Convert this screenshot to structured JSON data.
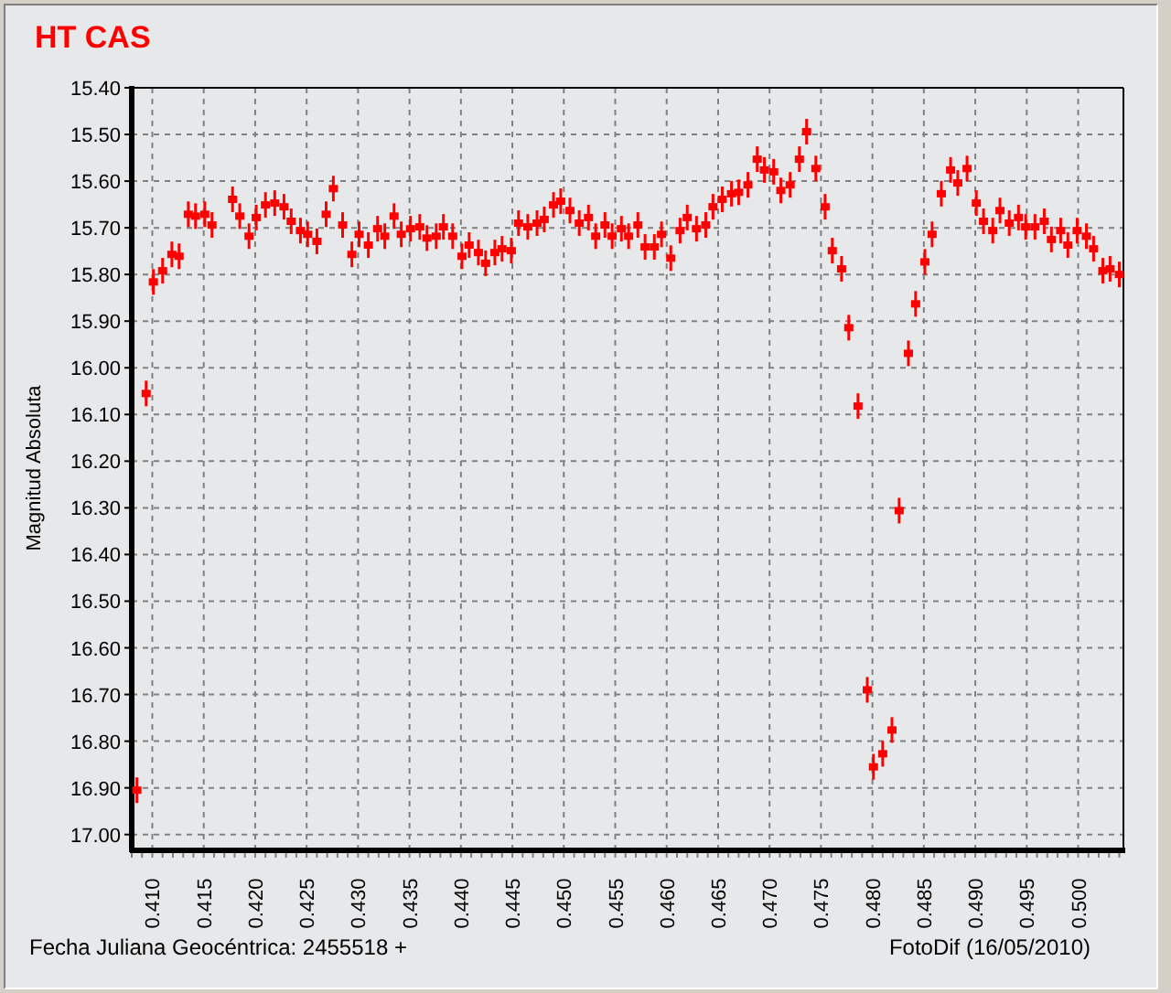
{
  "chart_data": {
    "type": "scatter",
    "title": "HT CAS",
    "xlabel": "Fecha Juliana Geocéntrica: 2455518 +",
    "ylabel": "Magnitud Absoluta",
    "grid": true,
    "xlim": [
      0.408,
      0.5044
    ],
    "ylim": [
      17.03,
      15.4
    ],
    "xticks": [
      {
        "value": 0.41,
        "label": "0.410"
      },
      {
        "value": 0.415,
        "label": "0.415"
      },
      {
        "value": 0.42,
        "label": "0.420"
      },
      {
        "value": 0.425,
        "label": "0.425"
      },
      {
        "value": 0.43,
        "label": "0.430"
      },
      {
        "value": 0.435,
        "label": "0.435"
      },
      {
        "value": 0.44,
        "label": "0.440"
      },
      {
        "value": 0.445,
        "label": "0.445"
      },
      {
        "value": 0.45,
        "label": "0.450"
      },
      {
        "value": 0.455,
        "label": "0.455"
      },
      {
        "value": 0.46,
        "label": "0.460"
      },
      {
        "value": 0.465,
        "label": "0.465"
      },
      {
        "value": 0.47,
        "label": "0.470"
      },
      {
        "value": 0.475,
        "label": "0.475"
      },
      {
        "value": 0.48,
        "label": "0.480"
      },
      {
        "value": 0.485,
        "label": "0.485"
      },
      {
        "value": 0.49,
        "label": "0.490"
      },
      {
        "value": 0.495,
        "label": "0.495"
      },
      {
        "value": 0.5,
        "label": "0.500"
      }
    ],
    "yticks": [
      {
        "value": 15.4,
        "label": "15.40"
      },
      {
        "value": 15.5,
        "label": "15.50"
      },
      {
        "value": 15.6,
        "label": "15.60"
      },
      {
        "value": 15.7,
        "label": "15.70"
      },
      {
        "value": 15.8,
        "label": "15.80"
      },
      {
        "value": 15.9,
        "label": "15.90"
      },
      {
        "value": 16.0,
        "label": "16.00"
      },
      {
        "value": 16.1,
        "label": "16.10"
      },
      {
        "value": 16.2,
        "label": "16.20"
      },
      {
        "value": 16.3,
        "label": "16.30"
      },
      {
        "value": 16.4,
        "label": "16.40"
      },
      {
        "value": 16.5,
        "label": "16.50"
      },
      {
        "value": 16.6,
        "label": "16.60"
      },
      {
        "value": 16.7,
        "label": "16.70"
      },
      {
        "value": 16.8,
        "label": "16.80"
      },
      {
        "value": 16.9,
        "label": "16.90"
      },
      {
        "value": 17.0,
        "label": "17.00"
      }
    ],
    "x": [
      0.4085,
      0.4094,
      0.4101,
      0.411,
      0.4119,
      0.4126,
      0.4135,
      0.4142,
      0.4151,
      0.4158,
      0.4178,
      0.4185,
      0.4194,
      0.4201,
      0.421,
      0.4219,
      0.4228,
      0.4235,
      0.4244,
      0.4251,
      0.426,
      0.4269,
      0.4276,
      0.4285,
      0.4294,
      0.4301,
      0.431,
      0.4319,
      0.4326,
      0.4335,
      0.4342,
      0.4351,
      0.436,
      0.4367,
      0.4376,
      0.4383,
      0.4392,
      0.4401,
      0.4408,
      0.4417,
      0.4424,
      0.4433,
      0.444,
      0.4449,
      0.4456,
      0.4465,
      0.4474,
      0.4481,
      0.449,
      0.4497,
      0.4506,
      0.4515,
      0.4524,
      0.4531,
      0.454,
      0.4547,
      0.4556,
      0.4563,
      0.4572,
      0.4579,
      0.4588,
      0.4595,
      0.4604,
      0.4613,
      0.462,
      0.4629,
      0.4638,
      0.4645,
      0.4654,
      0.4663,
      0.467,
      0.4679,
      0.4688,
      0.4695,
      0.4704,
      0.4711,
      0.472,
      0.4729,
      0.4736,
      0.4745,
      0.4754,
      0.4761,
      0.477,
      0.4777,
      0.4786,
      0.4795,
      0.4801,
      0.481,
      0.4819,
      0.4826,
      0.4835,
      0.4842,
      0.4851,
      0.4858,
      0.4867,
      0.4876,
      0.4883,
      0.4892,
      0.4901,
      0.4908,
      0.4917,
      0.4924,
      0.4933,
      0.4942,
      0.4949,
      0.4958,
      0.4967,
      0.4974,
      0.4983,
      0.499,
      0.4999,
      0.5008,
      0.5015,
      0.5024,
      0.5031,
      0.504
    ],
    "series": [
      {
        "color": "#ff0000",
        "values": [
          16.905,
          16.055,
          15.816,
          15.792,
          15.757,
          15.761,
          15.671,
          15.675,
          15.671,
          15.694,
          15.639,
          15.675,
          15.718,
          15.678,
          15.651,
          15.647,
          15.655,
          15.686,
          15.706,
          15.714,
          15.729,
          15.671,
          15.616,
          15.694,
          15.757,
          15.714,
          15.737,
          15.702,
          15.718,
          15.675,
          15.714,
          15.702,
          15.698,
          15.722,
          15.718,
          15.698,
          15.718,
          15.761,
          15.737,
          15.753,
          15.776,
          15.753,
          15.745,
          15.749,
          15.69,
          15.698,
          15.69,
          15.682,
          15.651,
          15.643,
          15.663,
          15.69,
          15.678,
          15.718,
          15.694,
          15.718,
          15.702,
          15.718,
          15.694,
          15.741,
          15.741,
          15.714,
          15.765,
          15.706,
          15.678,
          15.702,
          15.694,
          15.655,
          15.639,
          15.627,
          15.624,
          15.608,
          15.553,
          15.576,
          15.58,
          15.62,
          15.608,
          15.553,
          15.494,
          15.573,
          15.655,
          15.749,
          15.788,
          15.914,
          16.082,
          16.69,
          16.855,
          16.827,
          16.776,
          16.306,
          15.969,
          15.863,
          15.773,
          15.714,
          15.627,
          15.576,
          15.604,
          15.573,
          15.647,
          15.686,
          15.706,
          15.663,
          15.69,
          15.678,
          15.698,
          15.698,
          15.686,
          15.725,
          15.706,
          15.737,
          15.706,
          15.718,
          15.745,
          15.792,
          15.788,
          15.8
        ]
      }
    ]
  },
  "credit": "FotoDif (16/05/2010)"
}
